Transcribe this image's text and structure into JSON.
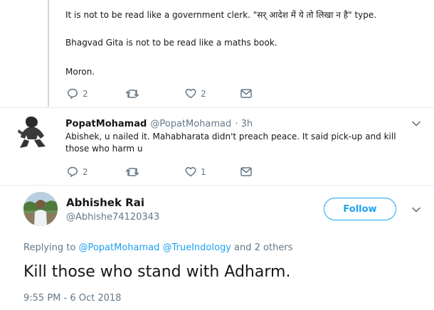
{
  "tweet_prev": {
    "lines": [
      "It is not to be read like a government clerk. \"सर् आदेश में ये तो लिखा न है\" type.",
      "Bhagvad Gita is not to be read like a maths book.",
      "Moron."
    ],
    "reply_count": "2",
    "like_count": "2"
  },
  "reply_tweet": {
    "name": "PopatMohamad",
    "handle": "@PopatMohamad",
    "time": "· 3h",
    "text_line1": "Abishek, u nailed it. Mahabharata didn't preach peace. It said pick-up and kill",
    "text_line2": "those who harm u",
    "reply_count": "2",
    "like_count": "1"
  },
  "main_tweet": {
    "name": "Abhishek Rai",
    "handle": "@Abhishe74120343",
    "follow_label": "Follow",
    "replying_prefix": "Replying to",
    "replying_user1": "@PopatMohamad",
    "replying_user2": "@TrueIndology",
    "replying_suffix": "and 2 others",
    "text": "Kill those who stand with Adharm.",
    "timestamp": "9:55 PM - 6 Oct 2018"
  },
  "colors": {
    "accent": "#1da1f2",
    "muted": "#657786",
    "text": "#14171a",
    "divider": "#e6ecf0"
  },
  "icons": [
    "reply-icon",
    "retweet-icon",
    "like-icon",
    "message-icon",
    "chevron-down-icon"
  ]
}
